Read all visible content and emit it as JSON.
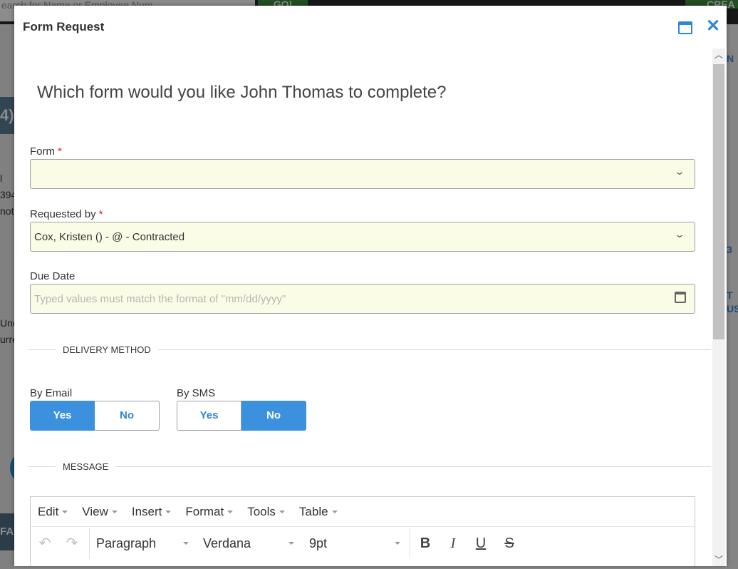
{
  "background": {
    "search_placeholder": "earch for Name or Employee Num",
    "go_label": "GO!",
    "create_label": "CREA",
    "badge_text": "4)",
    "left_fragments": [
      "l",
      "394",
      "notr",
      "Und",
      "urre"
    ],
    "fa_label": "FA",
    "right_fragments": [
      "N",
      "3",
      "T",
      "US"
    ]
  },
  "modal": {
    "title": "Form Request",
    "question": "Which form would you like John Thomas to complete?",
    "form_field": {
      "label": "Form",
      "required_mark": "*",
      "value": ""
    },
    "requested_by_field": {
      "label": "Requested by",
      "required_mark": "*",
      "value": "Cox, Kristen () -  @  - Contracted"
    },
    "due_date_field": {
      "label": "Due Date",
      "placeholder": "Typed values must match the format of \"mm/dd/yyyy\""
    },
    "delivery_section": "DELIVERY METHOD",
    "by_email": {
      "label": "By Email",
      "yes": "Yes",
      "no": "No",
      "selected": "Yes"
    },
    "by_sms": {
      "label": "By SMS",
      "yes": "Yes",
      "no": "No",
      "selected": "No"
    },
    "message_section": "MESSAGE",
    "editor": {
      "menus": [
        "Edit",
        "View",
        "Insert",
        "Format",
        "Tools",
        "Table"
      ],
      "block_format": "Paragraph",
      "font_family": "Verdana",
      "font_size": "9pt",
      "bold": "B",
      "italic": "I",
      "underline": "U",
      "strikethrough": "S"
    }
  },
  "colors": {
    "accent": "#3b91dd",
    "required": "#d9262b",
    "field_bg": "#fbfce6"
  }
}
